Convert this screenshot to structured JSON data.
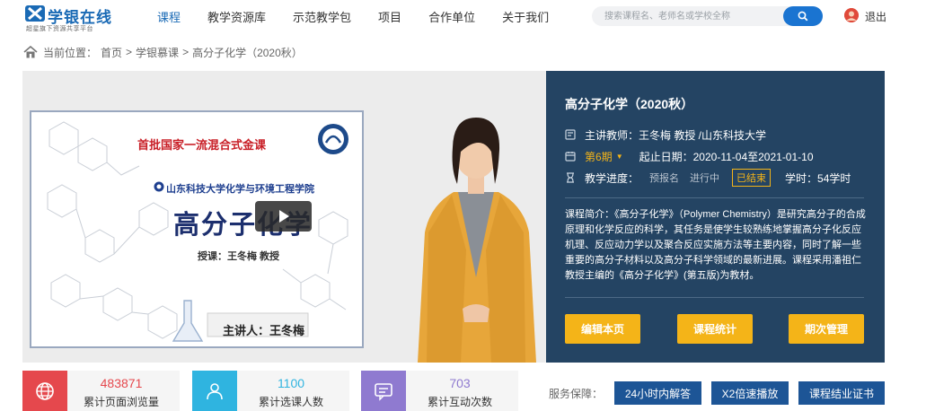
{
  "header": {
    "logo_name": "学银在线",
    "logo_slogan": "超星旗下资源共享平台",
    "nav": [
      {
        "label": "课程",
        "active": true
      },
      {
        "label": "教学资源库"
      },
      {
        "label": "示范教学包"
      },
      {
        "label": "项目"
      },
      {
        "label": "合作单位"
      },
      {
        "label": "关于我们"
      }
    ],
    "search_placeholder": "搜索课程名、老师名或学校全称",
    "logout": "退出",
    "brand_color": "#1a6ab5"
  },
  "breadcrumb": {
    "prefix": "当前位置：",
    "items": [
      "首页",
      "学银慕课",
      "高分子化学（2020秋）"
    ],
    "separator": ">"
  },
  "video": {
    "board_title": "首批国家一流混合式金课",
    "school": "山东科技大学化学与环境工程学院",
    "course": "高分子化学",
    "teacher_line": "授课：王冬梅 教授",
    "presenter_line": "主讲人：王冬梅"
  },
  "info": {
    "title": "高分子化学（2020秋）",
    "teacher_label": "主讲教师：",
    "teacher": "王冬梅 教授 /山东科技大学",
    "term": "第6期",
    "date_label": "起止日期：",
    "dates": "2020-11-04至2021-01-10",
    "progress_label": "教学进度：",
    "stages": [
      "预报名",
      "进行中",
      "已结束"
    ],
    "current_stage": "已结束",
    "hours": "学时：54学时",
    "description": "课程简介：《高分子化学》（Polymer Chemistry）是研究高分子的合成原理和化学反应的科学，其任务是使学生较熟练地掌握高分子化反应机理、反应动力学以及聚合反应实施方法等主要内容，同时了解一些重要的高分子材料以及高分子科学领域的最新进展。课程采用潘祖仁教授主编的《高分子化学》(第五版)为教材。",
    "buttons": [
      "编辑本页",
      "课程统计",
      "期次管理"
    ],
    "panel_color": "#244463",
    "accent_color": "#f4b418"
  },
  "stats": [
    {
      "value": "483871",
      "label": "累计页面浏览量",
      "color": "#e5484d"
    },
    {
      "value": "1100",
      "label": "累计选课人数",
      "color": "#2fb4e0"
    },
    {
      "value": "703",
      "label": "累计互动次数",
      "color": "#8f7ad0"
    }
  ],
  "guarantee": {
    "label": "服务保障：",
    "items": [
      "24小时内解答",
      "X2倍速播放",
      "课程结业证书"
    ]
  }
}
